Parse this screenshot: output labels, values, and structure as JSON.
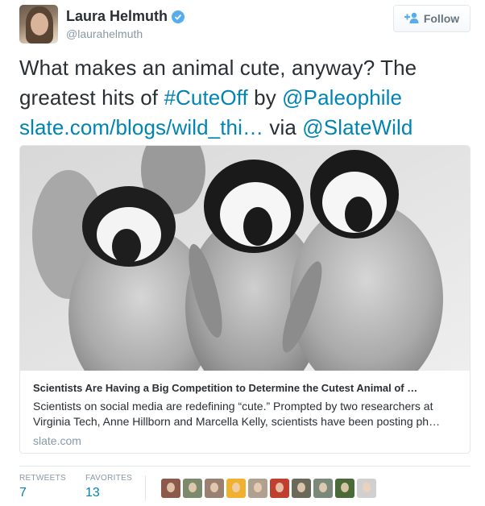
{
  "author": {
    "display_name": "Laura Helmuth",
    "handle": "@laurahelmuth",
    "verified": true
  },
  "follow_button": {
    "label": "Follow"
  },
  "tweet": {
    "line1": "What makes an animal cute, anyway? The",
    "line2_prefix": "greatest hits of ",
    "hashtag": "#CuteOff",
    "by": " by ",
    "mention1": "@Paleophile",
    "url": "slate.com/blogs/wild_thi…",
    "via": " via ",
    "mention2": "@SlateWild"
  },
  "card": {
    "title": "Scientists Are Having a Big Competition to Determine the Cutest Animal of …",
    "desc_line1": "Scientists on social media are redefining “cute.” Prompted by two researchers at",
    "desc_line2": "Virginia Tech, Anne Hillborn and Marcella Kelly, scientists have been posting ph…",
    "domain": "slate.com"
  },
  "stats": {
    "retweets_label": "RETWEETS",
    "retweets_value": "7",
    "favorites_label": "FAVORITES",
    "favorites_value": "13"
  },
  "favoriters": [
    {
      "color": "#8c5a4a"
    },
    {
      "color": "#7a8a6a"
    },
    {
      "color": "#9a8070"
    },
    {
      "color": "#f0b030"
    },
    {
      "color": "#b0a090"
    },
    {
      "color": "#c04030"
    },
    {
      "color": "#6a6a5a"
    },
    {
      "color": "#7a8a7a"
    },
    {
      "color": "#4a6a3a"
    },
    {
      "color": "#d0d0d0"
    }
  ],
  "colors": {
    "link": "#0084b4",
    "verified": "#55acee",
    "muted": "#8899a6",
    "text": "#292f33"
  }
}
